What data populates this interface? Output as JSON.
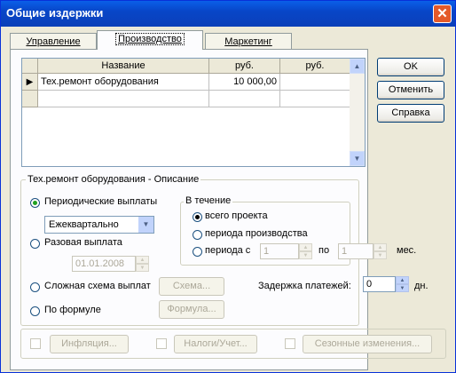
{
  "window": {
    "title": "Общие издержки",
    "close_glyph": "✕"
  },
  "tabs": [
    {
      "label": "Управление"
    },
    {
      "label": "Производство"
    },
    {
      "label": "Маркетинг"
    }
  ],
  "buttons": {
    "ok": "OK",
    "cancel": "Отменить",
    "help": "Справка"
  },
  "grid": {
    "columns": [
      "Название",
      "руб.",
      "руб."
    ],
    "rows": [
      {
        "marker": "▶",
        "name": "Тех.ремонт оборудования",
        "rub1": "10 000,00",
        "rub2": ""
      }
    ]
  },
  "description": {
    "title": "Тех.ремонт оборудования - Описание",
    "periodic": "Периодические выплаты",
    "periodic_value": "Ежеквартально",
    "single": "Разовая выплата",
    "single_date": "01.01.2008",
    "complex": "Сложная схема выплат",
    "scheme_btn": "Схема...",
    "formula": "По формуле",
    "formula_btn": "Формула...",
    "during": {
      "title": "В течение",
      "whole_project": "всего проекта",
      "production_period": "периода производства",
      "period_from": "периода с",
      "from_value": "1",
      "to_label": "по",
      "to_value": "1",
      "unit": "мес."
    },
    "delay": {
      "label": "Задержка платежей:",
      "value": "0",
      "unit": "дн."
    }
  },
  "bottom": {
    "inflation": "Инфляция...",
    "taxes": "Налоги/Учет...",
    "seasonal": "Сезонные изменения..."
  }
}
